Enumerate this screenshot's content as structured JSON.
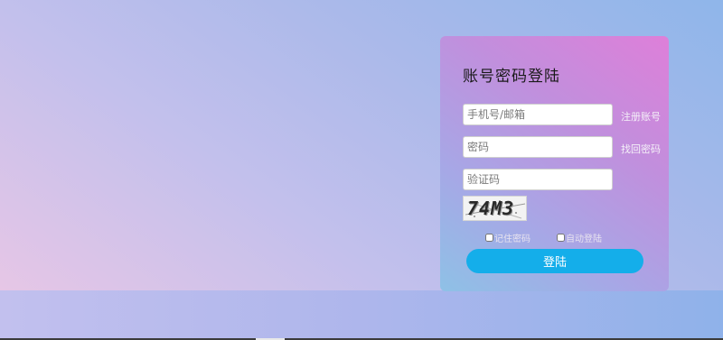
{
  "login": {
    "title": "账号密码登陆",
    "phone_placeholder": "手机号/邮箱",
    "password_placeholder": "密码",
    "captcha_placeholder": "验证码",
    "register_link": "注册账号",
    "forgot_link": "找回密码",
    "captcha_text": "74M3",
    "remember_label": "记住密码",
    "auto_login_label": "自动登陆",
    "submit_label": "登陆"
  },
  "colors": {
    "button": "#14aeea",
    "card_top": "#de7fd9",
    "card_bottom": "#8ec1e6"
  }
}
